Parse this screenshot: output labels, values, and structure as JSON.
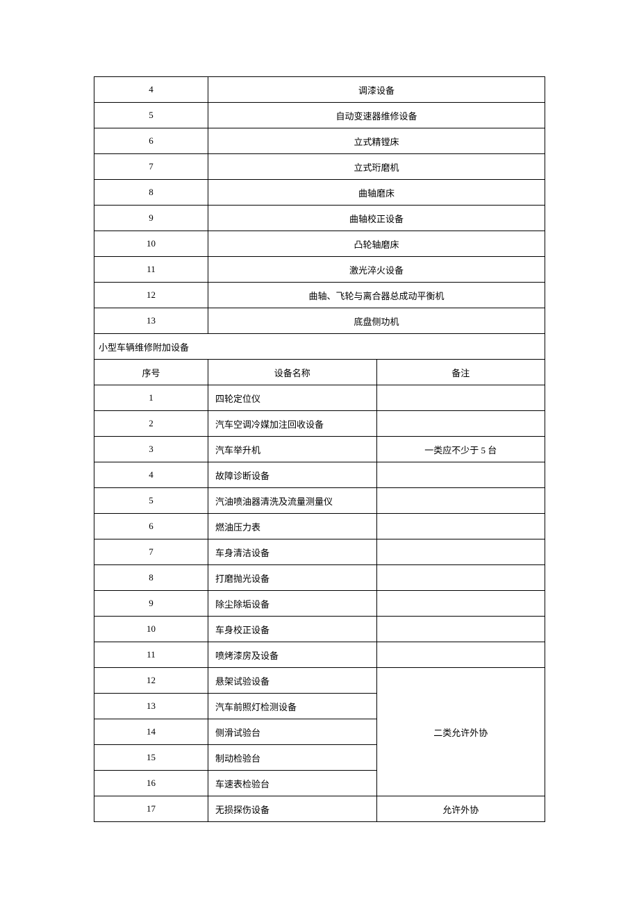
{
  "table1": {
    "rows": [
      {
        "num": "4",
        "name": "调漆设备"
      },
      {
        "num": "5",
        "name": "自动变速器维修设备"
      },
      {
        "num": "6",
        "name": "立式精镗床"
      },
      {
        "num": "7",
        "name": "立式珩磨机"
      },
      {
        "num": "8",
        "name": "曲轴磨床"
      },
      {
        "num": "9",
        "name": "曲轴校正设备"
      },
      {
        "num": "10",
        "name": "凸轮轴磨床"
      },
      {
        "num": "11",
        "name": "激光淬火设备"
      },
      {
        "num": "12",
        "name": "曲轴、飞轮与离合器总成动平衡机"
      },
      {
        "num": "13",
        "name": "底盘侧功机"
      }
    ]
  },
  "section_title": "小型车辆维修附加设备",
  "table2": {
    "headers": {
      "num": "序号",
      "name": "设备名称",
      "note": "备注"
    },
    "rows": [
      {
        "num": "1",
        "name": "四轮定位仪",
        "note": ""
      },
      {
        "num": "2",
        "name": "汽车空调冷媒加注回收设备",
        "note": ""
      },
      {
        "num": "3",
        "name": "汽车举升机",
        "note": "一类应不少于 5 台"
      },
      {
        "num": "4",
        "name": "故障诊断设备",
        "note": ""
      },
      {
        "num": "5",
        "name": "汽油喷油器清洗及流量测量仪",
        "note": ""
      },
      {
        "num": "6",
        "name": "燃油压力表",
        "note": ""
      },
      {
        "num": "7",
        "name": "车身清洁设备",
        "note": ""
      },
      {
        "num": "8",
        "name": "打磨抛光设备",
        "note": ""
      },
      {
        "num": "9",
        "name": "除尘除垢设备",
        "note": ""
      },
      {
        "num": "10",
        "name": "车身校正设备",
        "note": ""
      },
      {
        "num": "11",
        "name": "喷烤漆房及设备",
        "note": ""
      },
      {
        "num": "12",
        "name": "悬架试验设备"
      },
      {
        "num": "13",
        "name": "汽车前照灯检测设备"
      },
      {
        "num": "14",
        "name": "侧滑试验台"
      },
      {
        "num": "15",
        "name": "制动检验台"
      },
      {
        "num": "16",
        "name": "车速表检验台"
      },
      {
        "num": "17",
        "name": "无损探伤设备",
        "note": "允许外协"
      }
    ],
    "merged_note_12_16": "二类允许外协"
  }
}
